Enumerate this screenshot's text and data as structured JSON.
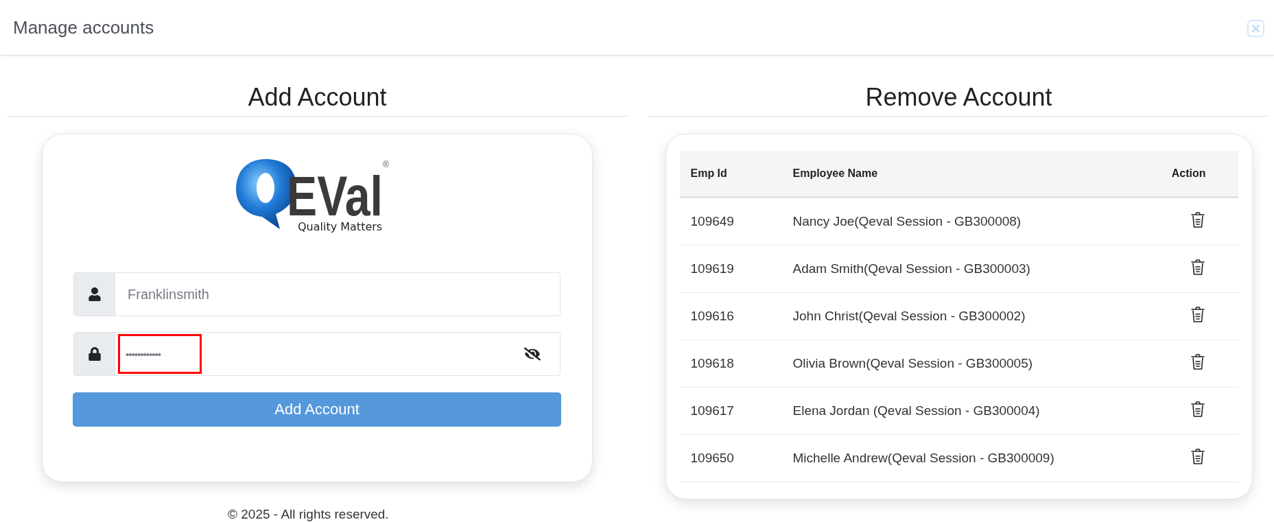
{
  "window": {
    "title": "Manage accounts"
  },
  "add_account": {
    "heading": "Add Account",
    "logo": {
      "wordmark": "EVal",
      "registered": "®",
      "tagline": "Quality Matters"
    },
    "username": {
      "value": "Franklinsmith"
    },
    "password": {
      "value": "••••••••••••",
      "highlighted": true
    },
    "button": "Add Account"
  },
  "remove_account": {
    "heading": "Remove Account",
    "table": {
      "columns": [
        "Emp Id",
        "Employee Name",
        "Action"
      ],
      "rows": [
        {
          "emp_id": "109649",
          "name": "Nancy Joe(Qeval Session - GB300008)"
        },
        {
          "emp_id": "109619",
          "name": "Adam Smith(Qeval Session - GB300003)"
        },
        {
          "emp_id": "109616",
          "name": "John Christ(Qeval Session - GB300002)"
        },
        {
          "emp_id": "109618",
          "name": "Olivia Brown(Qeval Session - GB300005)"
        },
        {
          "emp_id": "109617",
          "name": "Elena Jordan (Qeval Session - GB300004)"
        },
        {
          "emp_id": "109650",
          "name": "Michelle Andrew(Qeval Session - GB300009)"
        }
      ]
    }
  },
  "footer": "© 2025 - All rights reserved."
}
